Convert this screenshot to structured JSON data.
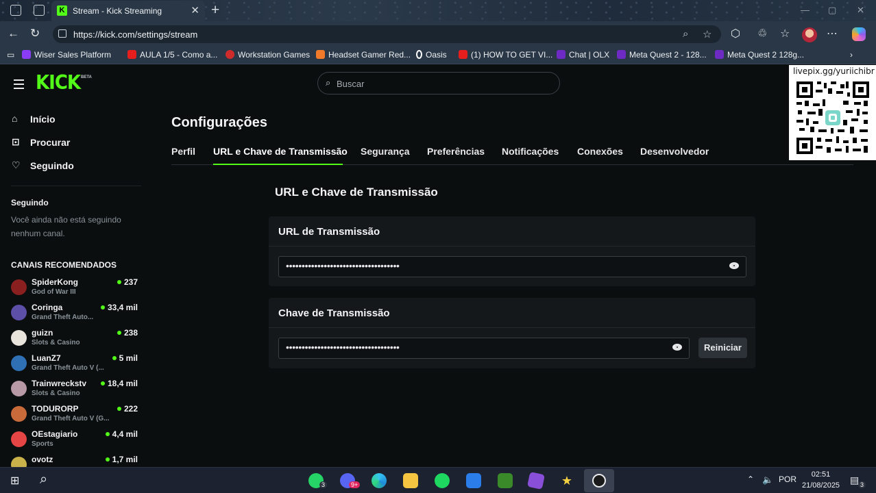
{
  "browser": {
    "tab_title": "Stream - Kick Streaming",
    "tab_favicon_letter": "K",
    "url": "https://kick.com/settings/stream",
    "bookmarks": [
      {
        "label": "Wiser Sales Platform",
        "color": "#8b3cf7"
      },
      {
        "label": "AULA 1/5 - Como a...",
        "color": "#e61e1e"
      },
      {
        "label": "Workstation Games",
        "color": "#d02b2b"
      },
      {
        "label": "Headset Gamer Red...",
        "color": "#f07a2a"
      },
      {
        "label": "Oasis",
        "color": "#ffffff"
      },
      {
        "label": "(1) HOW TO GET VI...",
        "color": "#e61e1e"
      },
      {
        "label": "Chat | OLX",
        "color": "#6e2bc4"
      },
      {
        "label": "Meta Quest 2 - 128...",
        "color": "#6e2bc4"
      },
      {
        "label": "Meta Quest 2 128g...",
        "color": "#6e2bc4"
      }
    ]
  },
  "header": {
    "logo": "KICK",
    "beta": "BETA",
    "search_placeholder": "Buscar"
  },
  "overlay": {
    "qr_label": "livepix.gg/yuriichibr"
  },
  "sidebar": {
    "nav": [
      {
        "label": "Início",
        "icon": "home-icon"
      },
      {
        "label": "Procurar",
        "icon": "browse-icon"
      },
      {
        "label": "Seguindo",
        "icon": "heart-icon"
      }
    ],
    "following_heading": "Seguindo",
    "following_note": "Você ainda não está seguindo nenhum canal.",
    "recommended_heading": "CANAIS RECOMENDADOS",
    "channels": [
      {
        "name": "SpiderKong",
        "category": "God of War III",
        "viewers": "237",
        "color": "#8a1f1f"
      },
      {
        "name": "Coringa",
        "category": "Grand Theft Auto...",
        "viewers": "33,4 mil",
        "color": "#5b4fa8"
      },
      {
        "name": "guizn",
        "category": "Slots & Casino",
        "viewers": "238",
        "color": "#e9e4dc"
      },
      {
        "name": "LuanZ7",
        "category": "Grand Theft Auto V (...",
        "viewers": "5 mil",
        "color": "#2f6fb3"
      },
      {
        "name": "Trainwreckstv",
        "category": "Slots & Casino",
        "viewers": "18,4 mil",
        "color": "#b89aa6"
      },
      {
        "name": "TODURORP",
        "category": "Grand Theft Auto V (G...",
        "viewers": "222",
        "color": "#c96a3a"
      },
      {
        "name": "OEstagiario",
        "category": "Sports",
        "viewers": "4,4 mil",
        "color": "#e64545"
      },
      {
        "name": "ovotz",
        "category": "",
        "viewers": "1,7 mil",
        "color": "#c9b24a"
      }
    ]
  },
  "settings": {
    "title": "Configurações",
    "tabs": [
      "Perfil",
      "URL e Chave de Transmissão",
      "Segurança",
      "Preferências",
      "Notificações",
      "Conexões",
      "Desenvolvedor"
    ],
    "active_tab": "URL e Chave de Transmissão",
    "section_title": "URL e Chave de Transmissão",
    "url_card_title": "URL de Transmissão",
    "url_value": "••••••••••••••••••••••••••••••••••••",
    "key_card_title": "Chave de Transmissão",
    "key_value": "••••••••••••••••••••••••••••••••••••",
    "reset_label": "Reiniciar"
  },
  "taskbar": {
    "whatsapp_badge": "3",
    "discord_badge": "9+",
    "language": "POR",
    "time": "02:51",
    "date": "21/08/2025",
    "notification_count": "3"
  }
}
